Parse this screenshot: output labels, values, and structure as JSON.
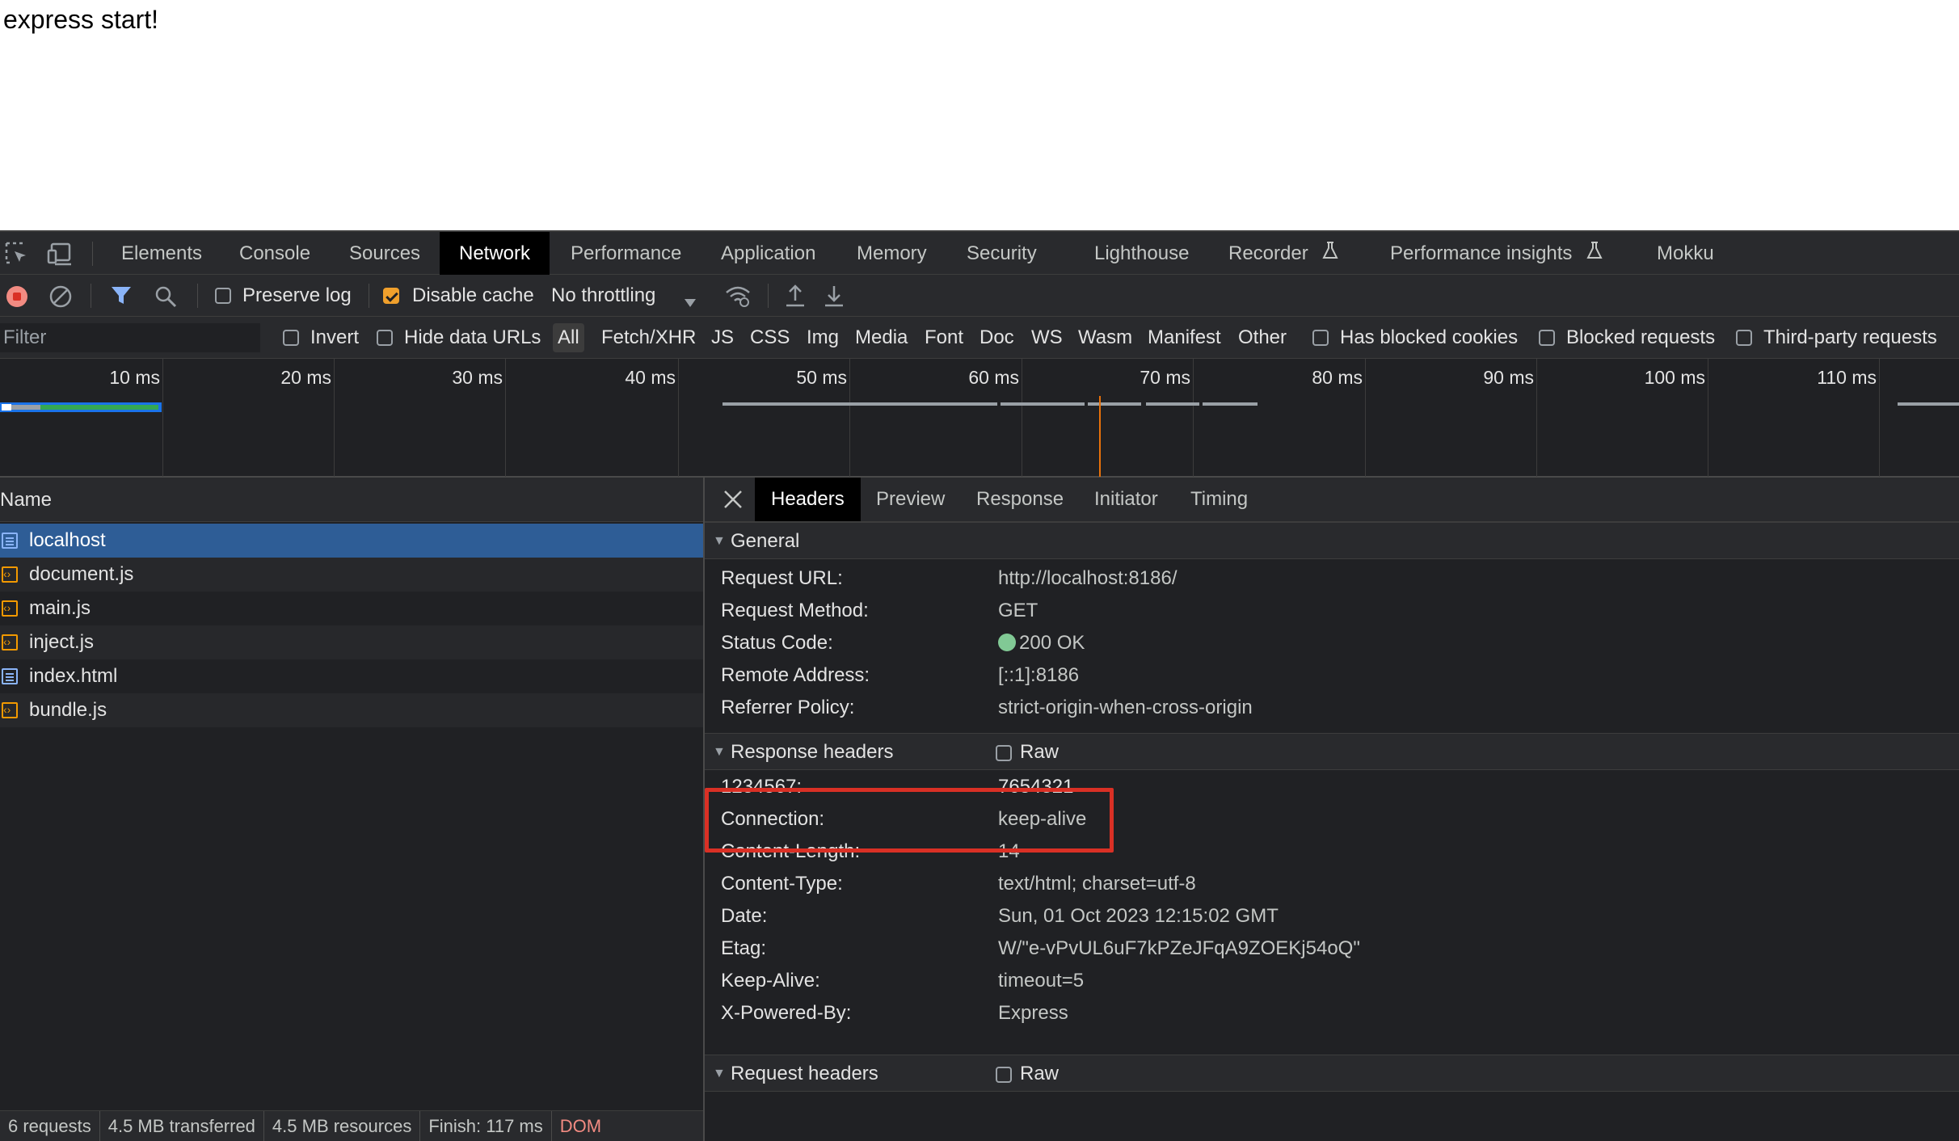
{
  "page": {
    "text": "express start!"
  },
  "devtools": {
    "tabs": [
      {
        "label": "Elements"
      },
      {
        "label": "Console"
      },
      {
        "label": "Sources"
      },
      {
        "label": "Network"
      },
      {
        "label": "Performance"
      },
      {
        "label": "Application"
      },
      {
        "label": "Memory"
      },
      {
        "label": "Security"
      },
      {
        "label": "Lighthouse"
      },
      {
        "label": "Recorder"
      },
      {
        "label": "Performance insights"
      },
      {
        "label": "Mokku"
      }
    ],
    "active_tab": "Network",
    "toolbar": {
      "preserve_log": "Preserve log",
      "preserve_log_checked": false,
      "disable_cache": "Disable cache",
      "disable_cache_checked": true,
      "throttling": "No throttling"
    },
    "filterbar": {
      "filter_placeholder": "Filter",
      "invert": "Invert",
      "hide_data_urls": "Hide data URLs",
      "types": [
        "All",
        "Fetch/XHR",
        "JS",
        "CSS",
        "Img",
        "Media",
        "Font",
        "Doc",
        "WS",
        "Wasm",
        "Manifest",
        "Other"
      ],
      "active_type": "All",
      "has_blocked_cookies": "Has blocked cookies",
      "blocked_requests": "Blocked requests",
      "third_party_requests": "Third-party requests"
    },
    "overview": {
      "ticks": [
        "10 ms",
        "20 ms",
        "30 ms",
        "40 ms",
        "50 ms",
        "60 ms",
        "70 ms",
        "80 ms",
        "90 ms",
        "100 ms",
        "110 ms"
      ]
    },
    "requests": {
      "column_name": "Name",
      "rows": [
        {
          "name": "localhost",
          "type": "doc",
          "selected": true
        },
        {
          "name": "document.js",
          "type": "script"
        },
        {
          "name": "main.js",
          "type": "script"
        },
        {
          "name": "inject.js",
          "type": "script"
        },
        {
          "name": "index.html",
          "type": "doc"
        },
        {
          "name": "bundle.js",
          "type": "script"
        }
      ]
    },
    "statusbar": {
      "requests": "6 requests",
      "transferred": "4.5 MB transferred",
      "resources": "4.5 MB resources",
      "finish": "Finish: 117 ms",
      "dom": "DOM"
    },
    "details": {
      "tabs": [
        "Headers",
        "Preview",
        "Response",
        "Initiator",
        "Timing"
      ],
      "active_tab": "Headers",
      "general": {
        "title": "General",
        "rows": [
          {
            "name": "Request URL:",
            "value": "http://localhost:8186/"
          },
          {
            "name": "Request Method:",
            "value": "GET"
          },
          {
            "name": "Status Code:",
            "value": "200 OK"
          },
          {
            "name": "Remote Address:",
            "value": "[::1]:8186"
          },
          {
            "name": "Referrer Policy:",
            "value": "strict-origin-when-cross-origin"
          }
        ]
      },
      "response_headers": {
        "title": "Response headers",
        "raw": "Raw",
        "rows": [
          {
            "name": "1234567:",
            "value": "7654321"
          },
          {
            "name": "Connection:",
            "value": "keep-alive"
          },
          {
            "name": "Content-Length:",
            "value": "14"
          },
          {
            "name": "Content-Type:",
            "value": "text/html; charset=utf-8"
          },
          {
            "name": "Date:",
            "value": "Sun, 01 Oct 2023 12:15:02 GMT"
          },
          {
            "name": "Etag:",
            "value": "W/\"e-vPvUL6uF7kPZeJFqA9ZOEKj54oQ\""
          },
          {
            "name": "Keep-Alive:",
            "value": "timeout=5"
          },
          {
            "name": "X-Powered-By:",
            "value": "Express"
          }
        ]
      },
      "request_headers": {
        "title": "Request headers",
        "raw": "Raw"
      }
    },
    "colors": {
      "accent_selected": "#2e5d96",
      "record_red": "#f28b82",
      "status_ok": "#81c995",
      "highlight_box": "#d93025",
      "checkbox_checked": "#f0a02c"
    }
  }
}
